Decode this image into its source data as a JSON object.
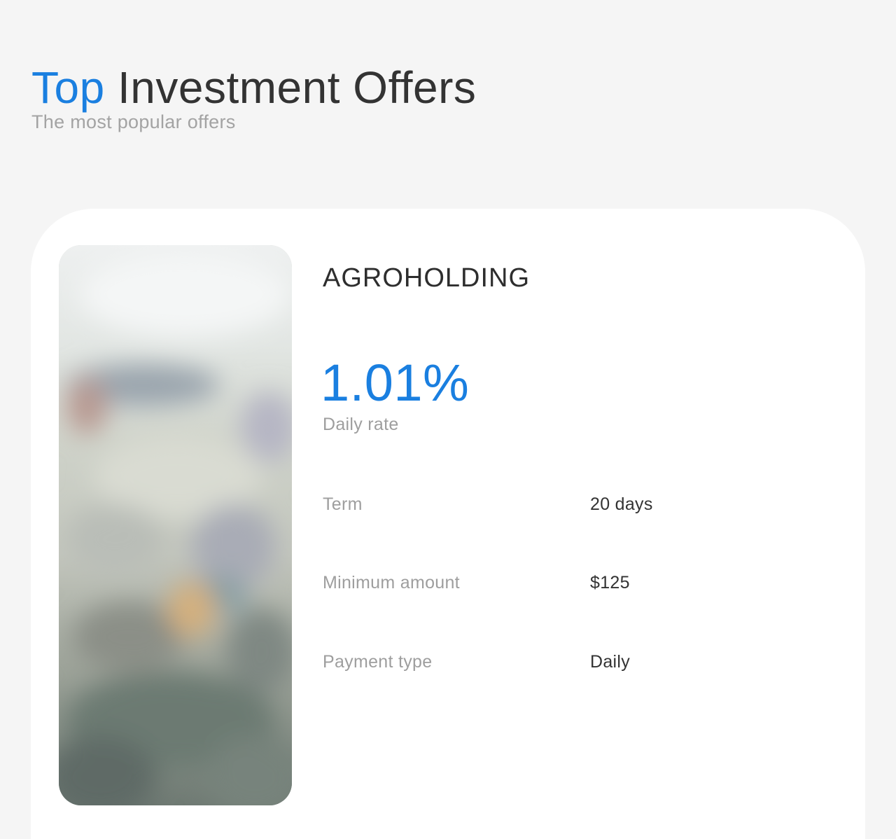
{
  "header": {
    "title_accent": "Top",
    "title_rest": "Investment Offers",
    "subtitle": "The most popular offers"
  },
  "offer": {
    "name": "AGROHOLDING",
    "rate": "1.01%",
    "rate_label": "Daily rate",
    "details": [
      {
        "label": "Term",
        "value": "20 days"
      },
      {
        "label": "Minimum amount",
        "value": "$125"
      },
      {
        "label": "Payment type",
        "value": "Daily"
      }
    ]
  },
  "colors": {
    "accent": "#1a7fe0",
    "text_primary": "#333333",
    "text_muted": "#9e9e9e",
    "background": "#f5f5f5",
    "card": "#ffffff"
  }
}
